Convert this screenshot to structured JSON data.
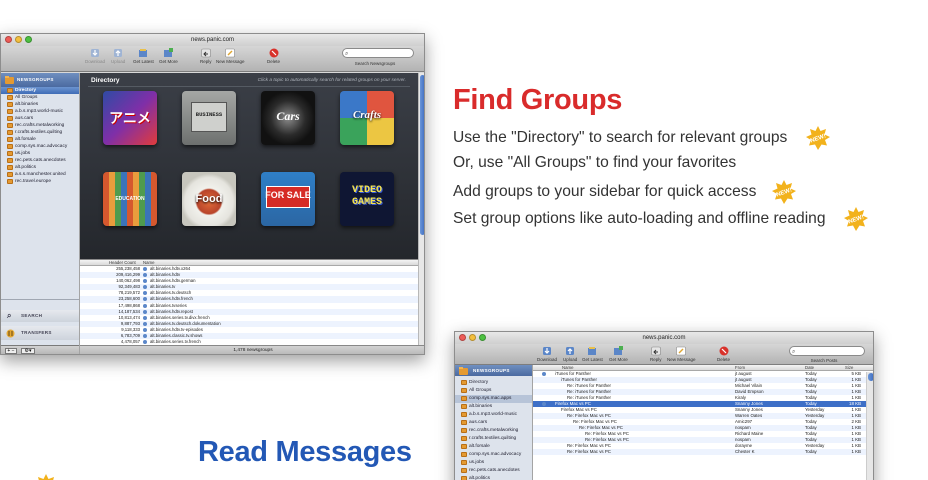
{
  "window1": {
    "title": "news.panic.com",
    "toolbar": {
      "download": "Download",
      "upload": "Upload",
      "get_latest": "Get Latest",
      "get_more": "Get More",
      "reply": "Reply",
      "new_message": "New Message",
      "delete": "Delete",
      "search_label": "Search Newsgroups"
    },
    "sidebar": {
      "section": "NEWSGROUPS",
      "items": [
        "Directory",
        "All Groups",
        "alt.binaries",
        "a.b.s.mp3.world-music",
        "aus.cars",
        "rec.crafts.metalworking",
        "r.crafts.textiles.quilting",
        "alt.forsale",
        "comp.sys.mac.advocacy",
        "us.jobs",
        "rec.pets.cats.anecdotes",
        "alt.politics",
        "a.s.s.manchester.united",
        "rec.travel.europe"
      ],
      "search": "SEARCH",
      "transfers": "TRANSFERS"
    },
    "directory": {
      "title": "Directory",
      "hint": "Click a topic to automatically search for related groups on your server.",
      "tiles": [
        "アニメ",
        "BUSINESS",
        "Cars",
        "Crafts",
        "EDUCATION",
        "Food",
        "FOR SALE",
        "VIDEO GAMES"
      ]
    },
    "list": {
      "col_count": "Header Count",
      "col_name": "Name",
      "rows": [
        {
          "count": "255,238,458",
          "name": "alt.binaries.hdtv.x264"
        },
        {
          "count": "209,416,299",
          "name": "alt.binaries.hdtv"
        },
        {
          "count": "140,062,498",
          "name": "alt.binaries.hdtv.german"
        },
        {
          "count": "92,349,483",
          "name": "alt.binaries.tv"
        },
        {
          "count": "78,219,572",
          "name": "alt.binaries.tv.deutsch"
        },
        {
          "count": "23,258,600",
          "name": "alt.binaries.hdtv.french"
        },
        {
          "count": "17,498,868",
          "name": "alt.binaries.tvseries"
        },
        {
          "count": "14,187,534",
          "name": "alt.binaries.hdtv.repost"
        },
        {
          "count": "10,813,474",
          "name": "alt.binaries.series.tv.divx.french"
        },
        {
          "count": "9,887,793",
          "name": "alt.binaries.tv.deutsch.dokumentation"
        },
        {
          "count": "9,118,333",
          "name": "alt.binaries.hdtv.tv-episodes"
        },
        {
          "count": "6,783,709",
          "name": "alt.binaries.classic.tv.shows"
        },
        {
          "count": "4,478,057",
          "name": "alt.binaries.series.tv.french"
        },
        {
          "count": "3,911,074",
          "name": "alt.binaries.multimedia.vintage-tv"
        },
        {
          "count": "3,545,899",
          "name": "alt.binaries.tv.swedish"
        },
        {
          "count": "3,287,783",
          "name": "alt.binaries.tv.big-brother"
        }
      ]
    },
    "status": "1,478 newsgroups"
  },
  "find_groups": {
    "heading": "Find Groups",
    "features": [
      {
        "text": "Use the \"Directory\" to search for relevant groups",
        "new": true
      },
      {
        "text": "Or, use \"All Groups\" to find your favorites",
        "new": false
      },
      {
        "text": "Add groups to your sidebar for quick access",
        "new": true
      },
      {
        "text": "Set group options like auto-loading and offline reading",
        "new": true
      }
    ],
    "badge_label": "NEW!"
  },
  "read_messages": {
    "heading": "Read Messages"
  },
  "window2": {
    "title": "news.panic.com",
    "toolbar": {
      "download": "Download",
      "upload": "Upload",
      "get_latest": "Get Latest",
      "get_more": "Get More",
      "reply": "Reply",
      "new_message": "New Message",
      "delete": "Delete",
      "search_label": "Search Posts"
    },
    "sidebar": {
      "section": "NEWSGROUPS",
      "items": [
        "Directory",
        "All Groups",
        "comp.sys.mac.apps",
        "alt.binaries",
        "a.b.s.mp3.world-music",
        "aus.cars",
        "rec.crafts.metalworking",
        "r.crafts.textiles.quilting",
        "alt.forsale",
        "comp.sys.mac.advocacy",
        "us.jobs",
        "rec.pets.cats.anecdotes",
        "alt.politics"
      ]
    },
    "columns": {
      "name": "Name",
      "from": "From",
      "date": "Date",
      "size": "Size"
    },
    "messages": [
      {
        "subject": "iTunes for Panther",
        "from": "jt august",
        "date": "Today",
        "size": "5 KB",
        "indent": 0,
        "selected": false
      },
      {
        "subject": "iTunes for Panther",
        "from": "jt august",
        "date": "Today",
        "size": "1 KB",
        "indent": 1,
        "selected": false
      },
      {
        "subject": "Re: iTunes for Panther",
        "from": "Michael Vilain",
        "date": "Today",
        "size": "1 KB",
        "indent": 2,
        "selected": false
      },
      {
        "subject": "Re: iTunes for Panther",
        "from": "David Empson",
        "date": "Today",
        "size": "1 KB",
        "indent": 2,
        "selected": false
      },
      {
        "subject": "Re: iTunes for Panther",
        "from": "Kiraly",
        "date": "Today",
        "size": "1 KB",
        "indent": 2,
        "selected": false
      },
      {
        "subject": "Firefox Mac vs PC",
        "from": "Snanny Jones",
        "date": "Today",
        "size": "18 KB",
        "indent": 0,
        "selected": true
      },
      {
        "subject": "Firefox Mac vs PC",
        "from": "Snanny Jones",
        "date": "Yesterday",
        "size": "1 KB",
        "indent": 1,
        "selected": false
      },
      {
        "subject": "Re: Firefox Mac vs PC",
        "from": "Warren Oates",
        "date": "Yesterday",
        "size": "1 KB",
        "indent": 2,
        "selected": false
      },
      {
        "subject": "Re: Firefox Mac vs PC",
        "from": "Amic297",
        "date": "Today",
        "size": "2 KB",
        "indent": 3,
        "selected": false
      },
      {
        "subject": "Re: Firefox Mac vs PC",
        "from": "nospam",
        "date": "Today",
        "size": "1 KB",
        "indent": 4,
        "selected": false
      },
      {
        "subject": "Re: Firefox Mac vs PC",
        "from": "Richard Maine",
        "date": "Today",
        "size": "1 KB",
        "indent": 5,
        "selected": false
      },
      {
        "subject": "Re: Firefox Mac vs PC",
        "from": "nospam",
        "date": "Today",
        "size": "1 KB",
        "indent": 5,
        "selected": false
      },
      {
        "subject": "Re: Firefox Mac vs PC",
        "from": "dorayme",
        "date": "Yesterday",
        "size": "1 KB",
        "indent": 2,
        "selected": false
      },
      {
        "subject": "Re: Firefox Mac vs PC",
        "from": "Chester K",
        "date": "Today",
        "size": "1 KB",
        "indent": 2,
        "selected": false
      }
    ]
  },
  "colors": {
    "find_heading": "#d92b2b",
    "read_heading": "#2358b5",
    "badge": "#f2b21c",
    "selection": "#3d6fc7"
  }
}
